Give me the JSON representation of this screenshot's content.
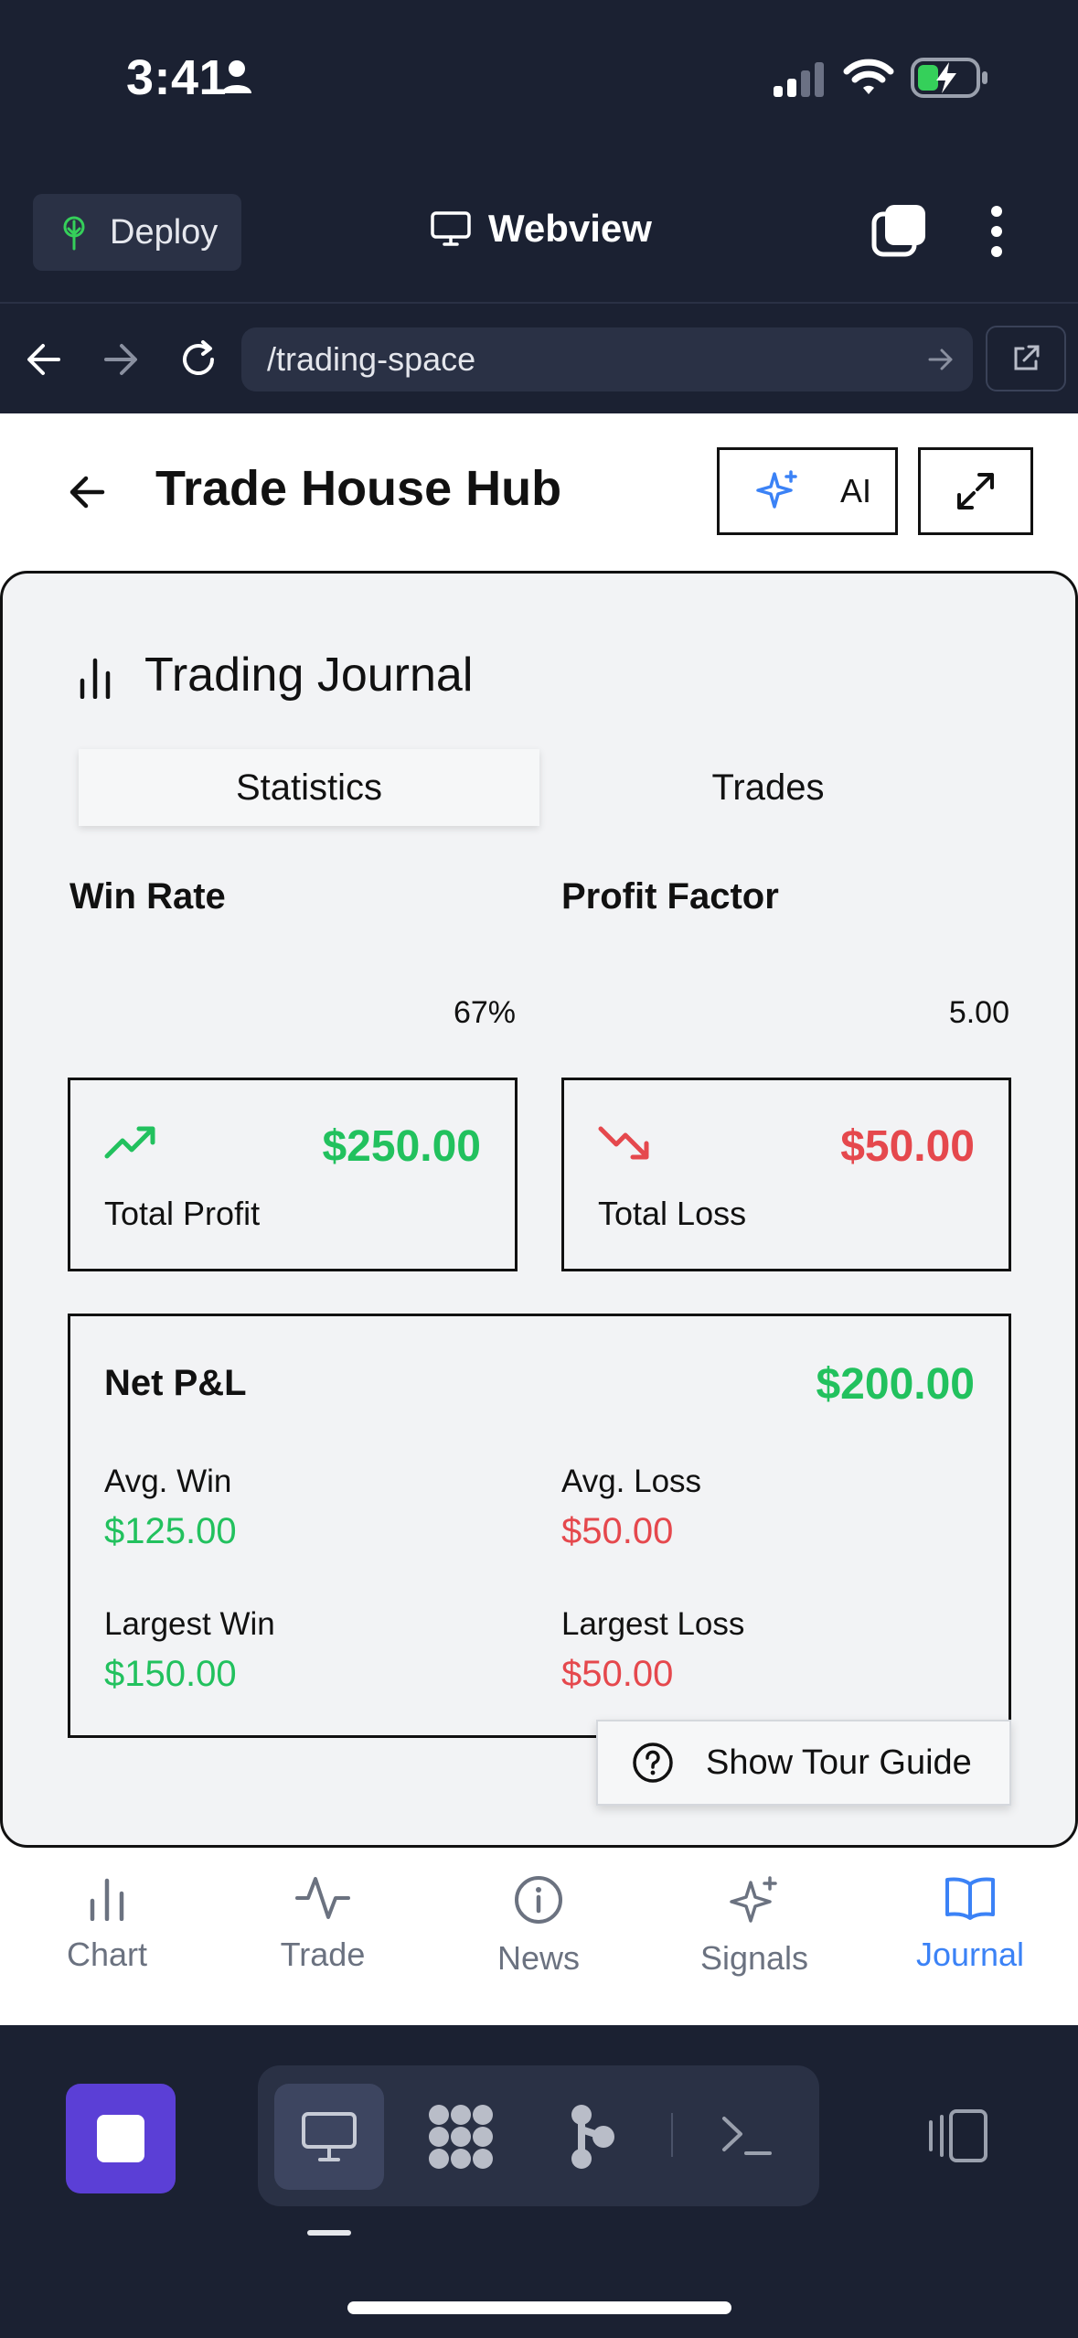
{
  "status_bar": {
    "time": "3:41"
  },
  "header": {
    "deploy_label": "Deploy",
    "title": "Webview"
  },
  "url_bar": {
    "url": "/trading-space"
  },
  "app": {
    "title": "Trade House Hub",
    "ai_label": "AI"
  },
  "journal": {
    "title": "Trading Journal",
    "tabs": [
      {
        "label": "Statistics",
        "active": true
      },
      {
        "label": "Trades",
        "active": false
      }
    ],
    "win_rate": {
      "label": "Win Rate",
      "value": "67%"
    },
    "profit_factor": {
      "label": "Profit Factor",
      "value": "5.00"
    },
    "total_profit": {
      "amount": "$250.00",
      "label": "Total Profit"
    },
    "total_loss": {
      "amount": "$50.00",
      "label": "Total Loss"
    },
    "net_pnl": {
      "label": "Net P&L",
      "amount": "$200.00",
      "avg_win_label": "Avg. Win",
      "avg_win": "$125.00",
      "avg_loss_label": "Avg. Loss",
      "avg_loss": "$50.00",
      "largest_win_label": "Largest Win",
      "largest_win": "$150.00",
      "largest_loss_label": "Largest Loss",
      "largest_loss": "$50.00"
    },
    "tour_label": "Show Tour Guide"
  },
  "bottom_nav": [
    {
      "label": "Chart",
      "icon": "bar-chart-icon"
    },
    {
      "label": "Trade",
      "icon": "activity-icon"
    },
    {
      "label": "News",
      "icon": "info-icon"
    },
    {
      "label": "Signals",
      "icon": "sparkles-icon"
    },
    {
      "label": "Journal",
      "icon": "book-icon",
      "active": true
    }
  ],
  "colors": {
    "profit": "#22c15e",
    "loss": "#e5484d",
    "accent": "#3b82f6",
    "stop": "#5b3fd6",
    "chrome": "#1b2132"
  }
}
